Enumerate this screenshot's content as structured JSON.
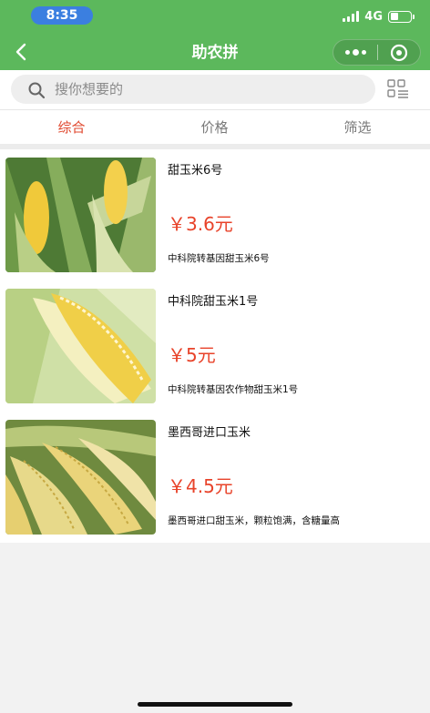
{
  "status_bar": {
    "time": "8:35",
    "network": "4G"
  },
  "nav": {
    "title": "助农拼"
  },
  "search": {
    "placeholder": "搜你想要的"
  },
  "tabs": [
    {
      "label": "综合",
      "active": true
    },
    {
      "label": "价格",
      "active": false
    },
    {
      "label": "筛选",
      "active": false
    }
  ],
  "products": [
    {
      "name": "甜玉米6号",
      "price": "￥3.6元",
      "desc": "中科院转基因甜玉米6号"
    },
    {
      "name": "中科院甜玉米1号",
      "price": "￥5元",
      "desc": "中科院转基因农作物甜玉米1号"
    },
    {
      "name": "墨西哥进口玉米",
      "price": "￥4.5元",
      "desc": "墨西哥进口甜玉米，颗粒饱满，含糖量高"
    }
  ],
  "colors": {
    "header_green": "#5cb85c",
    "accent_red": "#e0472d",
    "price_red": "#e8432a"
  }
}
